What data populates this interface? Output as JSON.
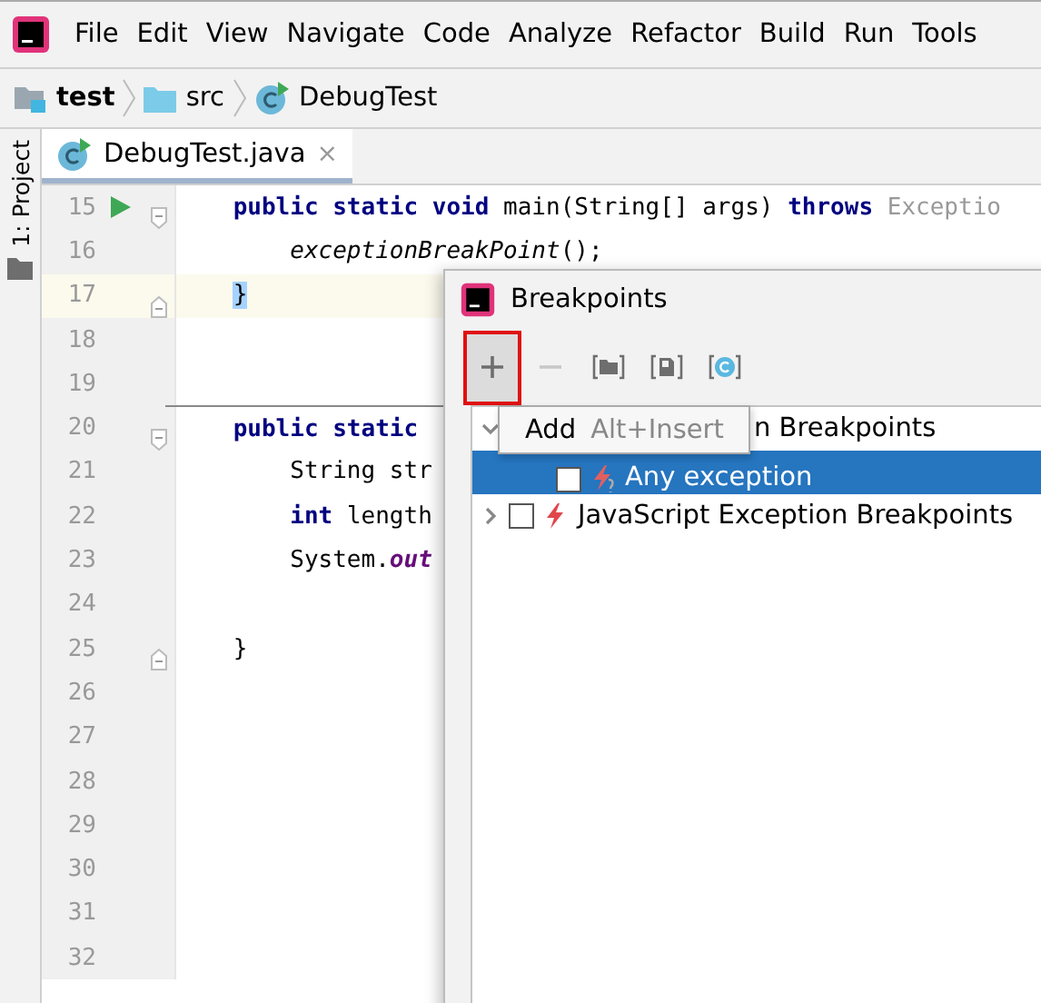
{
  "menu": [
    "File",
    "Edit",
    "View",
    "Navigate",
    "Code",
    "Analyze",
    "Refactor",
    "Build",
    "Run",
    "Tools"
  ],
  "breadcrumb": [
    {
      "label": "test",
      "kind": "module"
    },
    {
      "label": "src",
      "kind": "folder"
    },
    {
      "label": "DebugTest",
      "kind": "class"
    }
  ],
  "tool_stripe": {
    "label": "1: Project"
  },
  "tabs": [
    {
      "label": "DebugTest.java",
      "selected": true,
      "close": "×"
    }
  ],
  "editor": {
    "lines": [
      {
        "number": "15",
        "current": false,
        "runnable": true,
        "fold_start": true,
        "fold_end": false,
        "separator": false,
        "kind": "signature",
        "tokens": [
          {
            "kind": "keyword",
            "text": "public static void "
          },
          {
            "kind": "plain",
            "text": "main(String[] args) "
          },
          {
            "kind": "keyword",
            "text": "throws "
          },
          {
            "kind": "hint",
            "text": "Exceptio"
          }
        ]
      },
      {
        "number": "16",
        "current": false,
        "runnable": false,
        "fold_start": false,
        "fold_end": false,
        "separator": false,
        "kind": "statement",
        "tokens": [
          {
            "kind": "italic",
            "text": "exceptionBreakPoint"
          },
          {
            "kind": "plain",
            "text": "();"
          }
        ]
      },
      {
        "number": "17",
        "current": true,
        "runnable": false,
        "fold_start": false,
        "fold_end": true,
        "separator": false,
        "kind": "block_end",
        "tokens": [
          {
            "kind": "brace",
            "text": "}"
          }
        ]
      },
      {
        "number": "18",
        "current": false,
        "runnable": false,
        "fold_start": false,
        "fold_end": false,
        "separator": false
      },
      {
        "number": "19",
        "current": false,
        "runnable": false,
        "fold_start": false,
        "fold_end": false,
        "separator": false
      },
      {
        "number": "20",
        "current": false,
        "runnable": false,
        "fold_start": true,
        "fold_end": false,
        "separator": true,
        "kind": "signature",
        "tokens": [
          {
            "kind": "keyword",
            "text": "public static"
          }
        ]
      },
      {
        "number": "21",
        "current": false,
        "runnable": false,
        "fold_start": false,
        "fold_end": false,
        "separator": false,
        "kind": "statement",
        "tokens": [
          {
            "kind": "plain",
            "text": "String str"
          }
        ]
      },
      {
        "number": "22",
        "current": false,
        "runnable": false,
        "fold_start": false,
        "fold_end": false,
        "separator": false,
        "kind": "statement",
        "tokens": [
          {
            "kind": "keyword",
            "text": "int "
          },
          {
            "kind": "plain",
            "text": "length"
          }
        ]
      },
      {
        "number": "23",
        "current": false,
        "runnable": false,
        "fold_start": false,
        "fold_end": false,
        "separator": false,
        "kind": "statement",
        "tokens": [
          {
            "kind": "plain",
            "text": "System."
          },
          {
            "kind": "field",
            "text": "out"
          }
        ]
      },
      {
        "number": "24",
        "current": false,
        "runnable": false,
        "fold_start": false,
        "fold_end": false,
        "separator": false
      },
      {
        "number": "25",
        "current": false,
        "runnable": false,
        "fold_start": false,
        "fold_end": true,
        "separator": false,
        "kind": "block_end",
        "tokens": [
          {
            "kind": "plain",
            "text": "}"
          }
        ]
      },
      {
        "number": "26",
        "current": false,
        "runnable": false,
        "fold_start": false,
        "fold_end": false,
        "separator": false
      },
      {
        "number": "27",
        "current": false,
        "runnable": false,
        "fold_start": false,
        "fold_end": false,
        "separator": false
      },
      {
        "number": "28",
        "current": false,
        "runnable": false,
        "fold_start": false,
        "fold_end": false,
        "separator": false
      },
      {
        "number": "29",
        "current": false,
        "runnable": false,
        "fold_start": false,
        "fold_end": false,
        "separator": false
      },
      {
        "number": "30",
        "current": false,
        "runnable": false,
        "fold_start": false,
        "fold_end": false,
        "separator": false
      },
      {
        "number": "31",
        "current": false,
        "runnable": false,
        "fold_start": false,
        "fold_end": false,
        "separator": false
      },
      {
        "number": "32",
        "current": false,
        "runnable": false,
        "fold_start": false,
        "fold_end": false,
        "separator": false
      }
    ]
  },
  "dialog": {
    "title": "Breakpoints",
    "toolbar": [
      {
        "kind": "add",
        "disabled": false,
        "hovered": true,
        "annotated": true
      },
      {
        "kind": "remove",
        "disabled": true,
        "hovered": false,
        "annotated": false
      },
      {
        "kind": "group",
        "disabled": false,
        "hovered": false,
        "annotated": false
      },
      {
        "kind": "file",
        "disabled": false,
        "hovered": false,
        "annotated": false
      },
      {
        "kind": "class",
        "disabled": false,
        "hovered": false,
        "annotated": false
      }
    ],
    "tree": [
      {
        "label": "n Breakpoints",
        "kind": "partial",
        "expanded": true,
        "selected": false,
        "children": [
          {
            "label": "Any exception",
            "kind": "exception-any",
            "selected": true,
            "checked": false
          }
        ]
      },
      {
        "label": "JavaScript Exception Breakpoints",
        "kind": "exception",
        "expanded": false,
        "selected": false,
        "checked": false
      }
    ],
    "tooltip": {
      "label": "Add",
      "shortcut": "Alt+Insert"
    }
  }
}
